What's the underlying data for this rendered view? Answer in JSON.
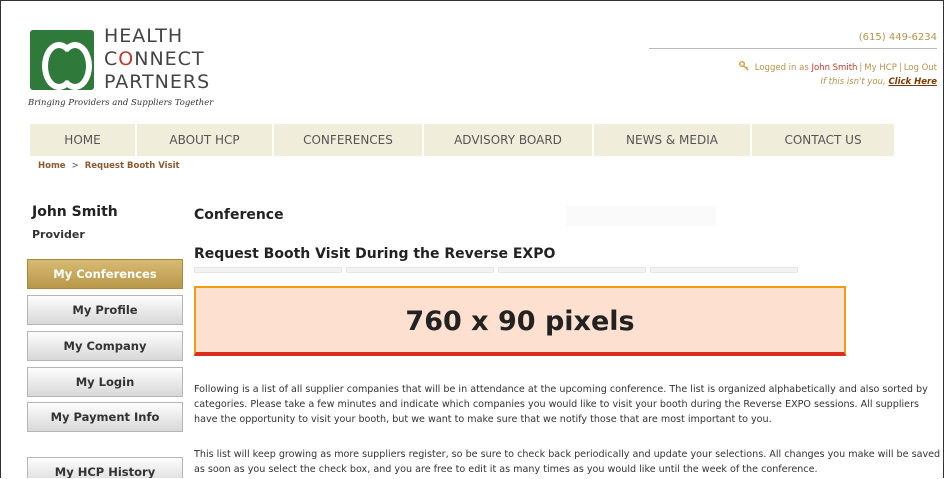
{
  "brand": {
    "line1": "HEALTH",
    "line2_pre": "C",
    "line2_o": "O",
    "line2_post": "NNECT",
    "line3": "PARTNERS",
    "tagline": "Bringing Providers and Suppliers Together"
  },
  "header": {
    "phone": "(615) 449-6234",
    "logged_in_prefix": "Logged in as",
    "user_link": "John Smith",
    "my_hcp": "My HCP",
    "logout": "Log Out",
    "not_you": "If this isn't you,",
    "click_here": "Click Here"
  },
  "nav": {
    "items": [
      {
        "label": "HOME"
      },
      {
        "label": "ABOUT HCP"
      },
      {
        "label": "CONFERENCES"
      },
      {
        "label": "ADVISORY BOARD"
      },
      {
        "label": "NEWS & MEDIA"
      },
      {
        "label": "CONTACT US"
      }
    ]
  },
  "breadcrumb": {
    "home": "Home",
    "separator": ">",
    "current": "Request Booth Visit"
  },
  "sidebar": {
    "user_name": "John Smith",
    "user_role": "Provider",
    "items": [
      {
        "label": "My Conferences",
        "active": true
      },
      {
        "label": "My Profile"
      },
      {
        "label": "My Company"
      },
      {
        "label": "My Login"
      },
      {
        "label": "My Payment Info"
      },
      {
        "label": "My HCP History"
      }
    ]
  },
  "main": {
    "conference_label": "Conference",
    "page_title": "Request Booth Visit During the Reverse EXPO",
    "ad_placeholder": "760 x 90 pixels",
    "paragraph1": "Following is a list of all supplier companies that will be in attendance at the upcoming conference. The list is organized alphabetically and also sorted by categories. Please take a few minutes and indicate which companies you would like to visit your booth during the Reverse EXPO sessions. All suppliers have the opportunity to visit your booth, but we want to make sure that we notify those that are most important to you.",
    "paragraph2": "This list will keep growing as more suppliers register, so be sure to check back periodically and update your selections. All changes you make will be saved as soon as you select the check box, and you are free to edit it as many times as you would like until the week of the conference."
  },
  "colors": {
    "gold": "#b8924a",
    "nav_bg": "#f0eedb",
    "active_btn": "#c5a55a",
    "banner_bg": "#fde0d0",
    "banner_border": "#f39c12",
    "logo_green": "#2f7a3a"
  }
}
